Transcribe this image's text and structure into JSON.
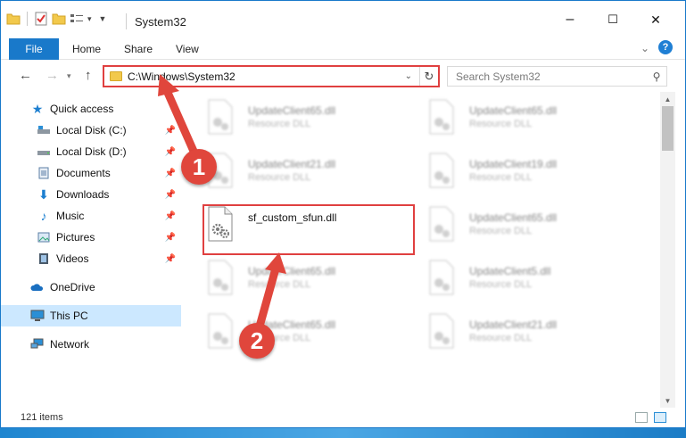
{
  "window": {
    "title": "System32",
    "controls": {
      "minimize": "–",
      "maximize": "☐",
      "close": "✕"
    }
  },
  "ribbon": {
    "tabs": [
      "File",
      "Home",
      "Share",
      "View"
    ],
    "help": "?"
  },
  "address_bar": {
    "path": "C:\\Windows\\System32",
    "search_placeholder": "Search System32"
  },
  "nav_pane": {
    "items": [
      {
        "label": "Quick access",
        "icon": "star-icon",
        "pinned": false
      },
      {
        "label": "Local Disk (C:)",
        "icon": "drive-icon",
        "pinned": true
      },
      {
        "label": "Local Disk (D:)",
        "icon": "drive-icon",
        "pinned": true
      },
      {
        "label": "Documents",
        "icon": "documents-icon",
        "pinned": true
      },
      {
        "label": "Downloads",
        "icon": "download-icon",
        "pinned": true
      },
      {
        "label": "Music",
        "icon": "music-icon",
        "pinned": true
      },
      {
        "label": "Pictures",
        "icon": "pictures-icon",
        "pinned": true
      },
      {
        "label": "Videos",
        "icon": "videos-icon",
        "pinned": true
      },
      {
        "label": "OneDrive",
        "icon": "cloud-icon",
        "pinned": false
      },
      {
        "label": "This PC",
        "icon": "computer-icon",
        "pinned": false,
        "selected": true
      },
      {
        "label": "Network",
        "icon": "network-icon",
        "pinned": false
      }
    ]
  },
  "files": [
    {
      "name": "UpdateClient65.dll",
      "type": "Resource DLL",
      "blurred": true
    },
    {
      "name": "UpdateClient65.dll",
      "type": "Resource DLL",
      "blurred": true
    },
    {
      "name": "UpdateClient21.dll",
      "type": "Resource DLL",
      "blurred": true
    },
    {
      "name": "UpdateClient19.dll",
      "type": "Resource DLL",
      "blurred": true
    },
    {
      "name": "sf_custom_sfun.dll",
      "type": "",
      "blurred": false,
      "highlighted": true
    },
    {
      "name": "UpdateClient65.dll",
      "type": "Resource DLL",
      "blurred": true
    },
    {
      "name": "UpdateClient65.dll",
      "type": "Resource DLL",
      "blurred": true
    },
    {
      "name": "UpdateClient5.dll",
      "type": "Resource DLL",
      "blurred": true
    },
    {
      "name": "UpdateClient65.dll",
      "type": "Resource DLL",
      "blurred": true
    },
    {
      "name": "UpdateClient21.dll",
      "type": "Resource DLL",
      "blurred": true
    }
  ],
  "status": {
    "item_count": "121 items"
  },
  "annotations": {
    "badge1": "1",
    "badge2": "2",
    "accent": "#e0463c"
  }
}
